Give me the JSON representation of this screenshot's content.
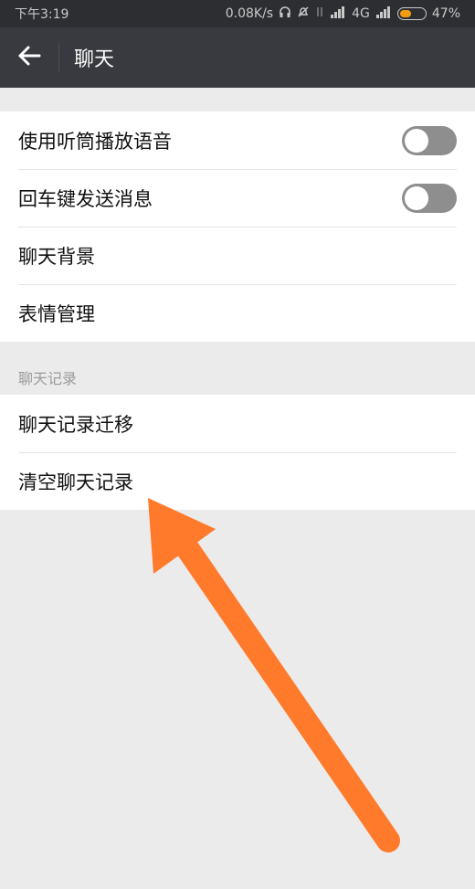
{
  "status_bar": {
    "time": "下午3:19",
    "net_speed": "0.08K/s",
    "network_type": "4G",
    "battery": "47%",
    "battery_level": 0.47,
    "battery_color": "#f39c12"
  },
  "header": {
    "title": "聊天",
    "back_icon": "arrow-left-icon"
  },
  "settings": [
    {
      "label": "使用听筒播放语音",
      "toggle": false
    },
    {
      "label": "回车键发送消息",
      "toggle": false
    },
    {
      "label": "聊天背景"
    },
    {
      "label": "表情管理"
    }
  ],
  "history": {
    "section_title": "聊天记录",
    "items": [
      {
        "label": "聊天记录迁移"
      },
      {
        "label": "清空聊天记录"
      }
    ]
  },
  "annotation": {
    "type": "arrow",
    "color": "#ff7a2a",
    "points_to": "清空聊天记录"
  }
}
